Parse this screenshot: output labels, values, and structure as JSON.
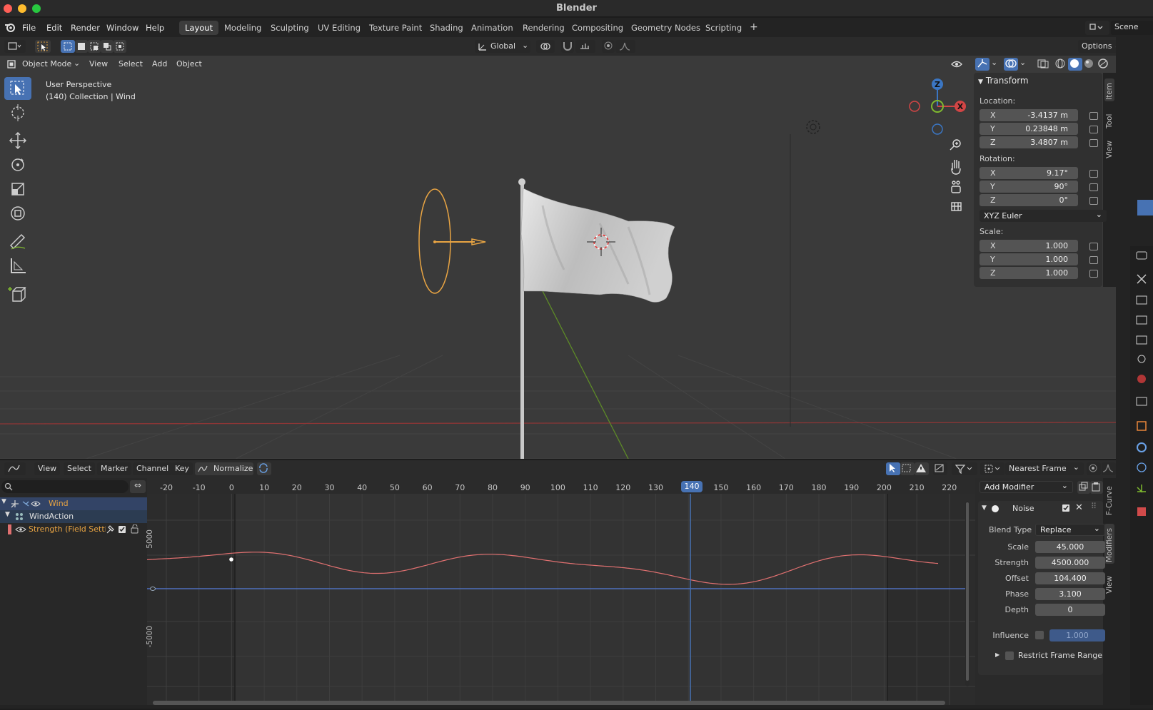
{
  "window": {
    "title": "Blender"
  },
  "menu": [
    "File",
    "Edit",
    "Render",
    "Window",
    "Help"
  ],
  "workspaces": [
    {
      "label": "Layout",
      "active": true
    },
    {
      "label": "Modeling"
    },
    {
      "label": "Sculpting"
    },
    {
      "label": "UV Editing"
    },
    {
      "label": "Texture Paint"
    },
    {
      "label": "Shading"
    },
    {
      "label": "Animation"
    },
    {
      "label": "Rendering"
    },
    {
      "label": "Compositing"
    },
    {
      "label": "Geometry Nodes"
    },
    {
      "label": "Scripting"
    }
  ],
  "add_workspace": "+",
  "scene": {
    "label": "Scene"
  },
  "toolbar": {
    "orientation": "Global",
    "options": "Options"
  },
  "viewport_header": {
    "mode": "Object Mode",
    "menus": [
      "View",
      "Select",
      "Add",
      "Object"
    ]
  },
  "viewport": {
    "perspective": "User Perspective",
    "collection": "(140) Collection | Wind",
    "gizmo": {
      "x": "X",
      "y": "Y",
      "z": "Z"
    }
  },
  "sidebar": {
    "tabs": [
      "Item",
      "Tool",
      "View"
    ],
    "transform_title": "Transform",
    "location_label": "Location:",
    "location": [
      {
        "axis": "X",
        "value": "-3.4137 m"
      },
      {
        "axis": "Y",
        "value": "0.23848 m"
      },
      {
        "axis": "Z",
        "value": "3.4807 m"
      }
    ],
    "rotation_label": "Rotation:",
    "rotation": [
      {
        "axis": "X",
        "value": "9.17°"
      },
      {
        "axis": "Y",
        "value": "90°"
      },
      {
        "axis": "Z",
        "value": "0°"
      }
    ],
    "rotation_mode": "XYZ Euler",
    "scale_label": "Scale:",
    "scale": [
      {
        "axis": "X",
        "value": "1.000"
      },
      {
        "axis": "Y",
        "value": "1.000"
      },
      {
        "axis": "Z",
        "value": "1.000"
      }
    ]
  },
  "graph_header": {
    "menus": [
      "View",
      "Select",
      "Marker",
      "Channel",
      "Key"
    ],
    "normalize": "Normalize",
    "snap": "Nearest Frame"
  },
  "channels": [
    {
      "label": "Wind",
      "level": 0
    },
    {
      "label": "WindAction",
      "level": 1
    },
    {
      "label": "Strength (Field Settin",
      "level": 2
    }
  ],
  "timeline": {
    "current_frame": 140,
    "ticks": [
      "-20",
      "-10",
      "0",
      "10",
      "20",
      "30",
      "40",
      "50",
      "60",
      "70",
      "80",
      "90",
      "100",
      "110",
      "120",
      "130",
      "140",
      "150",
      "160",
      "170",
      "180",
      "190",
      "200",
      "210",
      "220"
    ],
    "y_labels": [
      "5000",
      "-5000"
    ]
  },
  "modifier_panel": {
    "tabs": [
      "F-Curve",
      "Modifiers",
      "View"
    ],
    "add_modifier": "Add Modifier",
    "name": "Noise",
    "blend_type_label": "Blend Type",
    "blend_type": "Replace",
    "props": [
      {
        "label": "Scale",
        "value": "45.000"
      },
      {
        "label": "Strength",
        "value": "4500.000"
      },
      {
        "label": "Offset",
        "value": "104.400"
      },
      {
        "label": "Phase",
        "value": "3.100"
      },
      {
        "label": "Depth",
        "value": "0"
      }
    ],
    "influence_label": "Influence",
    "influence_value": "1.000",
    "restrict_label": "Restrict Frame Range"
  },
  "colors": {
    "accent": "#4772b3",
    "curve": "#e07070",
    "x_axis": "#c23b3b",
    "y_axis": "#6a9a2a",
    "wind": "#e8a443"
  }
}
